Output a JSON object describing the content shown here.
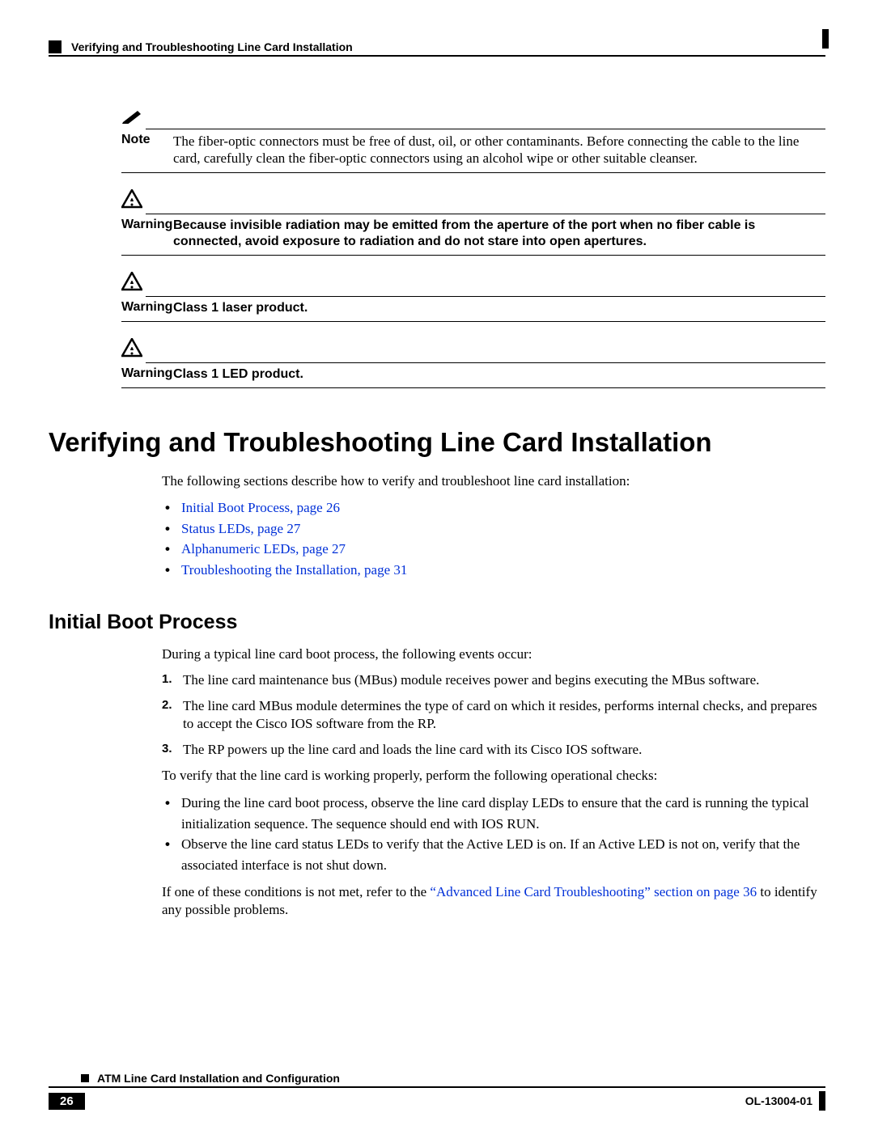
{
  "header": {
    "running_title": "Verifying and Troubleshooting Line Card Installation"
  },
  "note": {
    "label": "Note",
    "text": "The fiber-optic connectors must be free of dust, oil, or other contaminants. Before connecting the cable to the line card, carefully clean the fiber-optic connectors using an alcohol wipe or other suitable cleanser."
  },
  "warn1": {
    "label": "Warning",
    "text": "Because invisible radiation may be emitted from the aperture of the port when no fiber cable is connected, avoid exposure to radiation and do not stare into open apertures."
  },
  "warn2": {
    "label": "Warning",
    "text": "Class 1 laser product."
  },
  "warn3": {
    "label": "Warning",
    "text": "Class 1 LED product."
  },
  "section_title": "Verifying and Troubleshooting Line Card Installation",
  "intro": "The following sections describe how to verify and troubleshoot line card installation:",
  "toc": [
    "Initial Boot Process, page 26",
    "Status LEDs, page 27",
    "Alphanumeric LEDs, page 27",
    "Troubleshooting the Installation, page 31"
  ],
  "subsection_title": "Initial Boot Process",
  "sub_intro": "During a typical line card boot process, the following events occur:",
  "steps": [
    "The line card maintenance bus (MBus) module receives power and begins executing the MBus software.",
    "The line card MBus module determines the type of card on which it resides, performs internal checks, and prepares to accept the Cisco IOS software from the RP.",
    "The RP powers up the line card and loads the line card with its Cisco IOS software."
  ],
  "verify_intro": "To verify that the line card is working properly, perform the following operational checks:",
  "checks": [
    "During the line card boot process, observe the line card display LEDs to ensure that the card is running the typical initialization sequence. The sequence should end with IOS RUN.",
    "Observe the line card status LEDs to verify that the Active LED is on. If an Active LED is not on, verify that the associated interface is not shut down."
  ],
  "closing_pre": "If one of these conditions is not met, refer to the ",
  "closing_link": "“Advanced Line Card Troubleshooting” section on page 36",
  "closing_post": " to identify any possible problems.",
  "footer": {
    "doc_title": "ATM Line Card Installation and Configuration",
    "page_num": "26",
    "doc_id": "OL-13004-01"
  }
}
